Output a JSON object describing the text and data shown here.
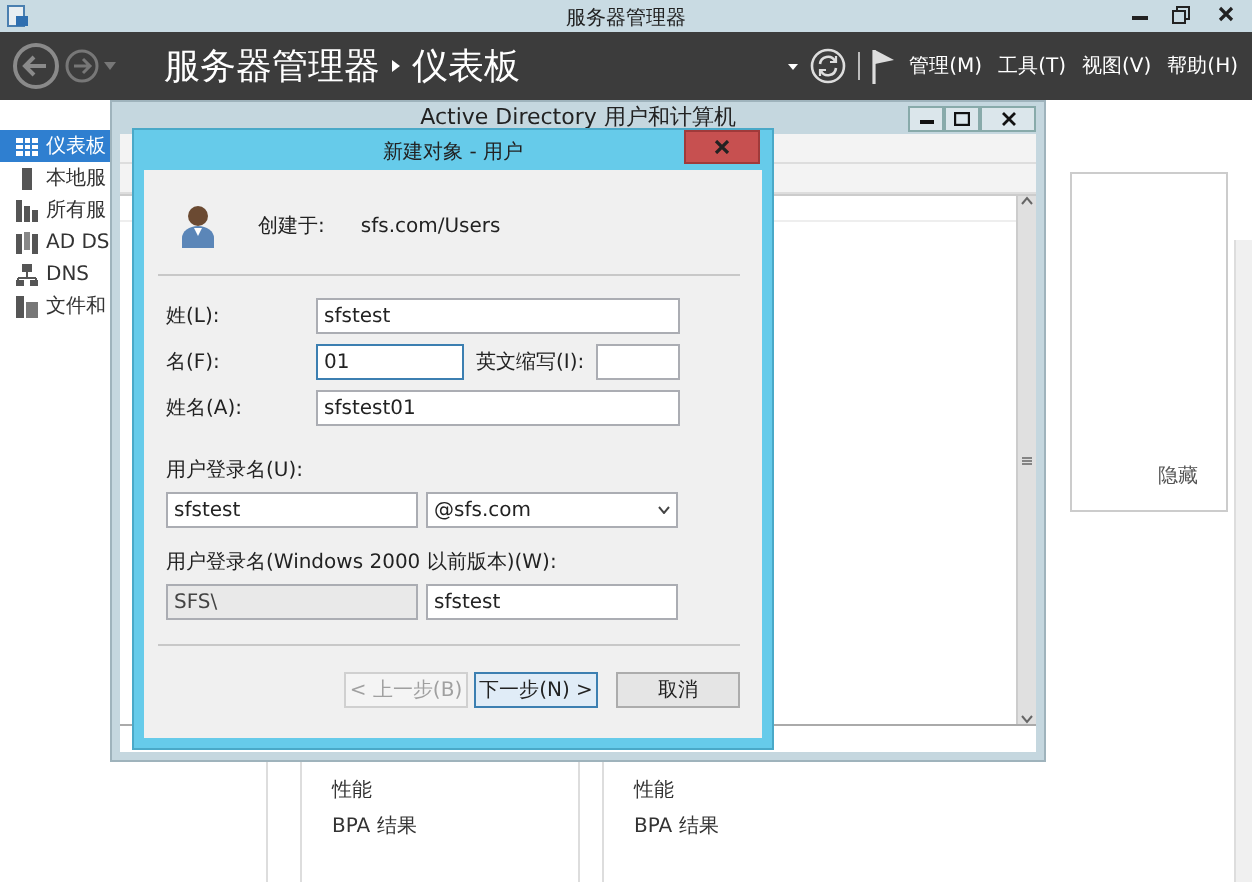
{
  "window": {
    "title": "服务器管理器"
  },
  "header": {
    "breadcrumb": [
      "服务器管理器",
      "仪表板"
    ],
    "menus": [
      "管理(M)",
      "工具(T)",
      "视图(V)",
      "帮助(H)"
    ]
  },
  "sidebar": {
    "items": [
      {
        "label": "仪表板",
        "kind": "dashboard",
        "selected": true
      },
      {
        "label": "本地服",
        "kind": "server",
        "selected": false
      },
      {
        "label": "所有服",
        "kind": "servers",
        "selected": false
      },
      {
        "label": "AD DS",
        "kind": "adds",
        "selected": false
      },
      {
        "label": "DNS",
        "kind": "dns",
        "selected": false
      },
      {
        "label": "文件和",
        "kind": "files",
        "selected": false
      }
    ]
  },
  "dashboard": {
    "hide_link": "隐藏",
    "tiles": [
      {
        "items": [
          "性能",
          "BPA 结果"
        ]
      },
      {
        "items": [
          "性能",
          "BPA 结果"
        ]
      }
    ]
  },
  "ad_window": {
    "title": "Active Directory 用户和计算机"
  },
  "dialog": {
    "title": "新建对象 - 用户",
    "created_in_label": "创建于:",
    "created_in": "sfs.com/Users",
    "last_name": {
      "label": "姓(L):",
      "value": "sfstest",
      "focused": false
    },
    "first_name": {
      "label": "名(F):",
      "value": "01",
      "focused": true
    },
    "initials": {
      "label": "英文缩写(I):",
      "focused": false
    },
    "full_name": {
      "label": "姓名(A):",
      "value": "sfstest01",
      "focused": false
    },
    "logon_label": "用户登录名(U):",
    "logon_name": "sfstest",
    "logon_domain": "@sfs.com",
    "legacy_label": "用户登录名(Windows 2000 以前版本)(W):",
    "legacy_prefix": "SFS\\",
    "legacy_name": "sfstest",
    "buttons": [
      {
        "label": "< 上一步(B)",
        "disabled": true,
        "default": false
      },
      {
        "label": "下一步(N) >",
        "disabled": false,
        "default": true
      },
      {
        "label": "取消",
        "disabled": false,
        "default": false
      }
    ]
  }
}
